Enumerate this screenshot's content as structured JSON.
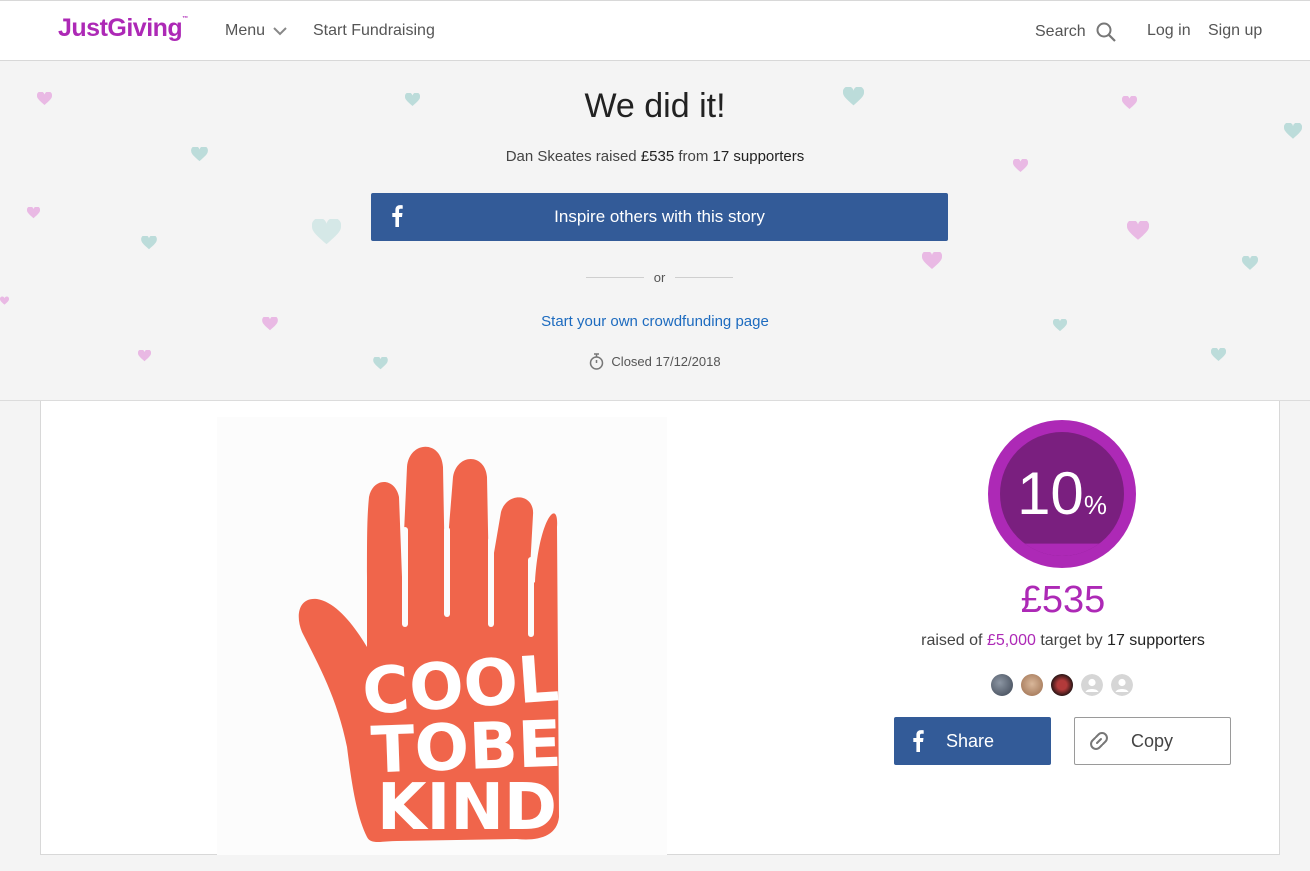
{
  "header": {
    "logo": "JustGiving",
    "logo_tm": "™",
    "menu_label": "Menu",
    "start_label": "Start Fundraising",
    "search_label": "Search",
    "login_label": "Log in",
    "signup_label": "Sign up"
  },
  "hero": {
    "title": "We did it!",
    "fundraiser": "Dan Skeates",
    "raised_word": "raised",
    "amount": "£535",
    "from_word": "from",
    "supporters": "17 supporters",
    "inspire_label": "Inspire others with this story",
    "or_label": "or",
    "start_link": "Start your own crowdfunding page",
    "closed_text": "Closed 17/12/2018"
  },
  "image": {
    "alt": "Cool To Be Kind hand logo",
    "line1": "COOL",
    "line2": "TOBE",
    "line3": "KIND"
  },
  "stats": {
    "percent": "10",
    "percent_sign": "%",
    "progress_fraction": 0.1,
    "raised": "£535",
    "raised_of": "raised of",
    "target": "£5,000",
    "target_by": "target by",
    "supporters": "17 supporters"
  },
  "actions": {
    "share_label": "Share",
    "copy_label": "Copy"
  },
  "colors": {
    "brand": "#ad29b6",
    "facebook": "#335b98",
    "link": "#1d6bbf",
    "circle_outer": "#ad29b6",
    "circle_inner": "#7a1f7f"
  }
}
